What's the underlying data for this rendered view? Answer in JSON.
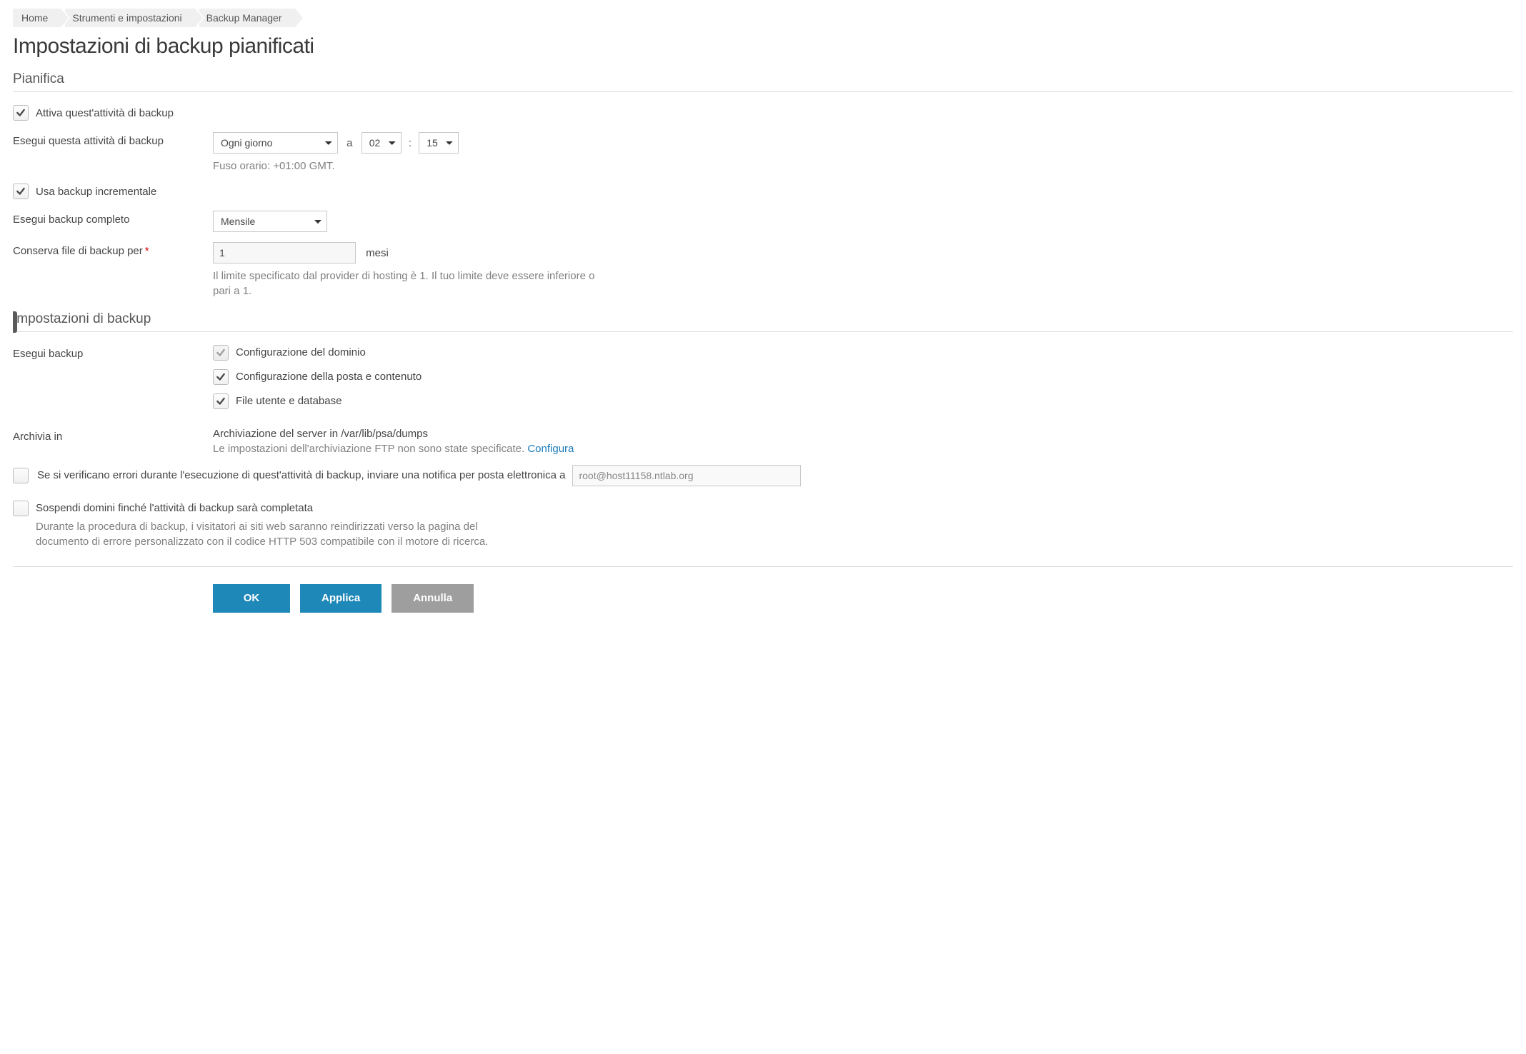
{
  "breadcrumb": {
    "items": [
      "Home",
      "Strumenti e impostazioni",
      "Backup Manager"
    ]
  },
  "page_title": "Impostazioni di backup pianificati",
  "schedule": {
    "section_title": "Pianifica",
    "activate_label": "Attiva quest'attività di backup",
    "activate_checked": true,
    "run_label": "Esegui questa attività di backup",
    "frequency_value": "Ogni giorno",
    "at_label": "a",
    "hour_value": "02",
    "colon": ":",
    "minute_value": "15",
    "timezone_hint": "Fuso orario: +01:00 GMT.",
    "incremental_label": "Usa backup incrementale",
    "incremental_checked": true,
    "full_backup_label": "Esegui backup completo",
    "full_backup_value": "Mensile",
    "retention_label": "Conserva file di backup per",
    "retention_value": "1",
    "retention_unit": "mesi",
    "retention_hint": "Il limite specificato dal provider di hosting è 1. Il tuo limite deve essere inferiore o pari a 1."
  },
  "settings": {
    "section_title": "Impostazioni di backup",
    "run_backup_label": "Esegui backup",
    "options": [
      {
        "label": "Configurazione del dominio",
        "checked": true,
        "disabled": true
      },
      {
        "label": "Configurazione della posta e contenuto",
        "checked": true,
        "disabled": false
      },
      {
        "label": "File utente e database",
        "checked": true,
        "disabled": false
      }
    ],
    "store_in_label": "Archivia in",
    "store_in_value": "Archiviazione del server in /var/lib/psa/dumps",
    "store_in_hint": "Le impostazioni dell'archiviazione FTP non sono state specificate. ",
    "store_in_link": "Configura",
    "notify_label": "Se si verificano errori durante l'esecuzione di quest'attività di backup, inviare una notifica per posta elettronica a",
    "notify_email": "root@host11158.ntlab.org",
    "notify_checked": false,
    "suspend_label": "Sospendi domini finché l'attività di backup sarà completata",
    "suspend_checked": false,
    "suspend_hint": "Durante la procedura di backup, i visitatori ai siti web saranno reindirizzati verso la pagina del documento di errore personalizzato con il codice HTTP 503 compatibile con il motore di ricerca."
  },
  "buttons": {
    "ok": "OK",
    "apply": "Applica",
    "cancel": "Annulla"
  }
}
